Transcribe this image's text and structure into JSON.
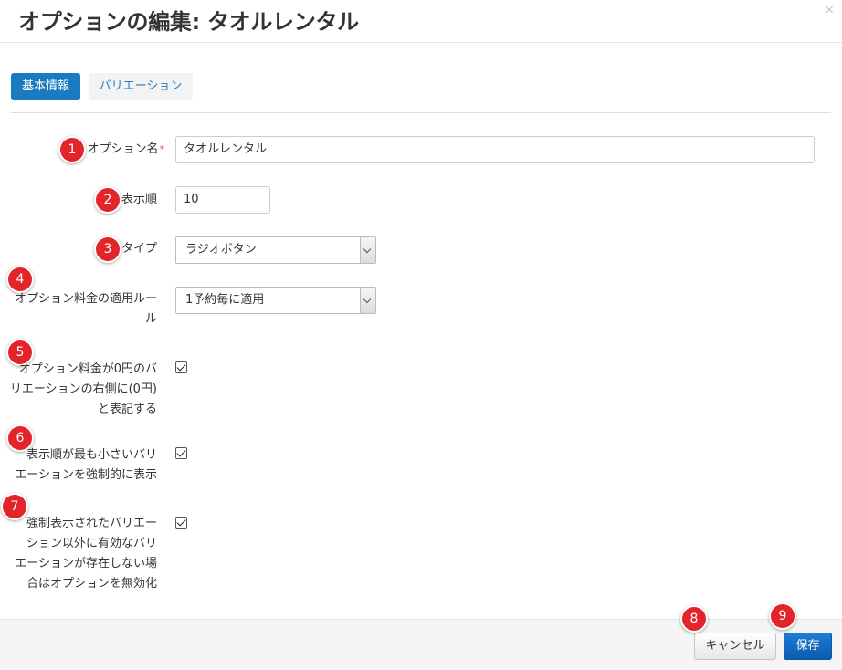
{
  "dialog": {
    "title": "オプションの編集: タオルレンタル",
    "close_glyph": "×"
  },
  "tabs": [
    {
      "label": "基本情報",
      "active": true
    },
    {
      "label": "バリエーション",
      "active": false
    }
  ],
  "form": {
    "option_name": {
      "label": "オプション名",
      "required_mark": "*",
      "value": "タオルレンタル"
    },
    "display_order": {
      "label": "表示順",
      "value": "10"
    },
    "type": {
      "label": "タイプ",
      "selected": "ラジオボタン"
    },
    "fee_rule": {
      "label_line1": "オプション料金の適用ルー",
      "label_line2": "ル",
      "selected": "1予約毎に適用"
    },
    "show_zero_yen": {
      "label_lines": [
        "オプション料金が0円のバ",
        "リエーションの右側に(0円)",
        "と表記する"
      ],
      "checked": true
    },
    "force_smallest": {
      "label_lines": [
        "表示順が最も小さいバリ",
        "エーションを強制的に表示"
      ],
      "checked": true
    },
    "disable_option": {
      "label_lines": [
        "強制表示されたバリエー",
        "ション以外に有効なバリ",
        "エーションが存在しない場",
        "合はオプションを無効化"
      ],
      "checked": true
    }
  },
  "badges": [
    "1",
    "2",
    "3",
    "4",
    "5",
    "6",
    "7",
    "8",
    "9"
  ],
  "footer": {
    "cancel_label": "キャンセル",
    "save_label": "保存"
  },
  "colors": {
    "primary": "#1a7bc0",
    "save_button": "#0a5cb0",
    "badge": "#e3242b",
    "required": "#d9534f"
  }
}
